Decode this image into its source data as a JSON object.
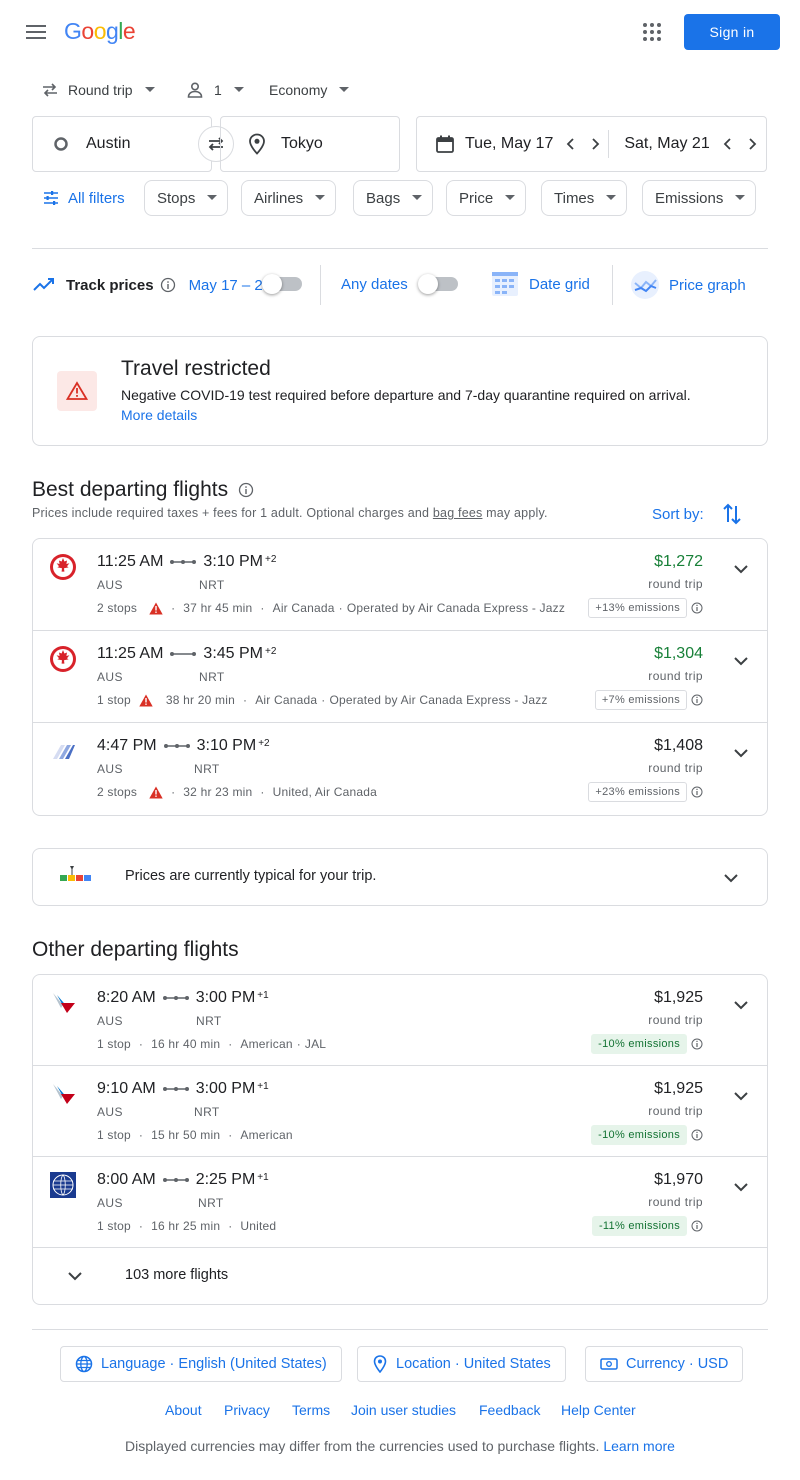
{
  "header": {
    "logo": "Google",
    "sign_in": "Sign in"
  },
  "options": {
    "trip_type": "Round trip",
    "passengers": "1",
    "cabin": "Economy"
  },
  "search": {
    "origin": "Austin",
    "destination": "Tokyo",
    "depart_date": "Tue, May 17",
    "return_date": "Sat, May 21"
  },
  "filters": {
    "all_filters": "All filters",
    "chips": [
      "Stops",
      "Airlines",
      "Bags",
      "Price",
      "Times",
      "Emissions"
    ]
  },
  "track": {
    "label": "Track prices",
    "range": "May 17 – 21",
    "any_dates": "Any dates",
    "date_grid": "Date grid",
    "price_graph": "Price graph"
  },
  "alert": {
    "title": "Travel restricted",
    "body": "Negative COVID-19 test required before departure and 7-day quarantine required on arrival.",
    "link": "More details"
  },
  "best": {
    "title": "Best departing flights",
    "sub_pre": "Prices include required taxes + fees for 1 adult. Optional charges and ",
    "sub_link": "bag fees",
    "sub_post": " may apply.",
    "sort_label": "Sort by:",
    "flights": [
      {
        "dep": "11:25 AM",
        "arr": "3:10 PM",
        "plus": "+2",
        "from": "AUS",
        "to": "NRT",
        "stops": "2 stops",
        "warn": true,
        "duration": "37 hr 45 min",
        "airline": "Air Canada",
        "operated": "Operated by Air Canada Express - Jazz",
        "price": "$1,272",
        "rt": "round trip",
        "emissions": "+13% emissions",
        "green": true
      },
      {
        "dep": "11:25 AM",
        "arr": "3:45 PM",
        "plus": "+2",
        "from": "AUS",
        "to": "NRT",
        "stops": "1 stop",
        "warn": true,
        "duration": "38 hr 20 min",
        "airline": "Air Canada",
        "operated": "Operated by Air Canada Express - Jazz",
        "price": "$1,304",
        "rt": "round trip",
        "emissions": "+7% emissions",
        "green": true
      },
      {
        "dep": "4:47 PM",
        "arr": "3:10 PM",
        "plus": "+2",
        "from": "AUS",
        "to": "NRT",
        "stops": "2 stops",
        "warn": true,
        "duration": "32 hr 23 min",
        "airline": "United, Air Canada",
        "operated": "",
        "price": "$1,408",
        "rt": "round trip",
        "emissions": "+23% emissions",
        "green": false
      }
    ]
  },
  "typical": {
    "text": "Prices are currently typical for your trip."
  },
  "other": {
    "title": "Other departing flights",
    "flights": [
      {
        "dep": "8:20 AM",
        "arr": "3:00 PM",
        "plus": "+1",
        "from": "AUS",
        "to": "NRT",
        "stops": "1 stop",
        "duration": "16 hr 40 min",
        "airline": "American",
        "operated": "JAL",
        "price": "$1,925",
        "rt": "round trip",
        "emissions": "-10% emissions"
      },
      {
        "dep": "9:10 AM",
        "arr": "3:00 PM",
        "plus": "+1",
        "from": "AUS",
        "to": "NRT",
        "stops": "1 stop",
        "duration": "15 hr 50 min",
        "airline": "American",
        "operated": "",
        "price": "$1,925",
        "rt": "round trip",
        "emissions": "-10% emissions"
      },
      {
        "dep": "8:00 AM",
        "arr": "2:25 PM",
        "plus": "+1",
        "from": "AUS",
        "to": "NRT",
        "stops": "1 stop",
        "duration": "16 hr 25 min",
        "airline": "United",
        "operated": "",
        "price": "$1,970",
        "rt": "round trip",
        "emissions": "-11% emissions"
      }
    ],
    "more": "103 more flights"
  },
  "footer": {
    "language": "Language · English (United States)",
    "location": "Location · United States",
    "currency": "Currency · USD",
    "links": [
      "About",
      "Privacy",
      "Terms",
      "Join user studies",
      "Feedback",
      "Help Center"
    ],
    "disclaimer": "Displayed currencies may differ from the currencies used to purchase flights.",
    "learn_more": "Learn more"
  },
  "colors": {
    "accent": "#1a73e8",
    "green": "#188038",
    "warning": "#d93025"
  }
}
